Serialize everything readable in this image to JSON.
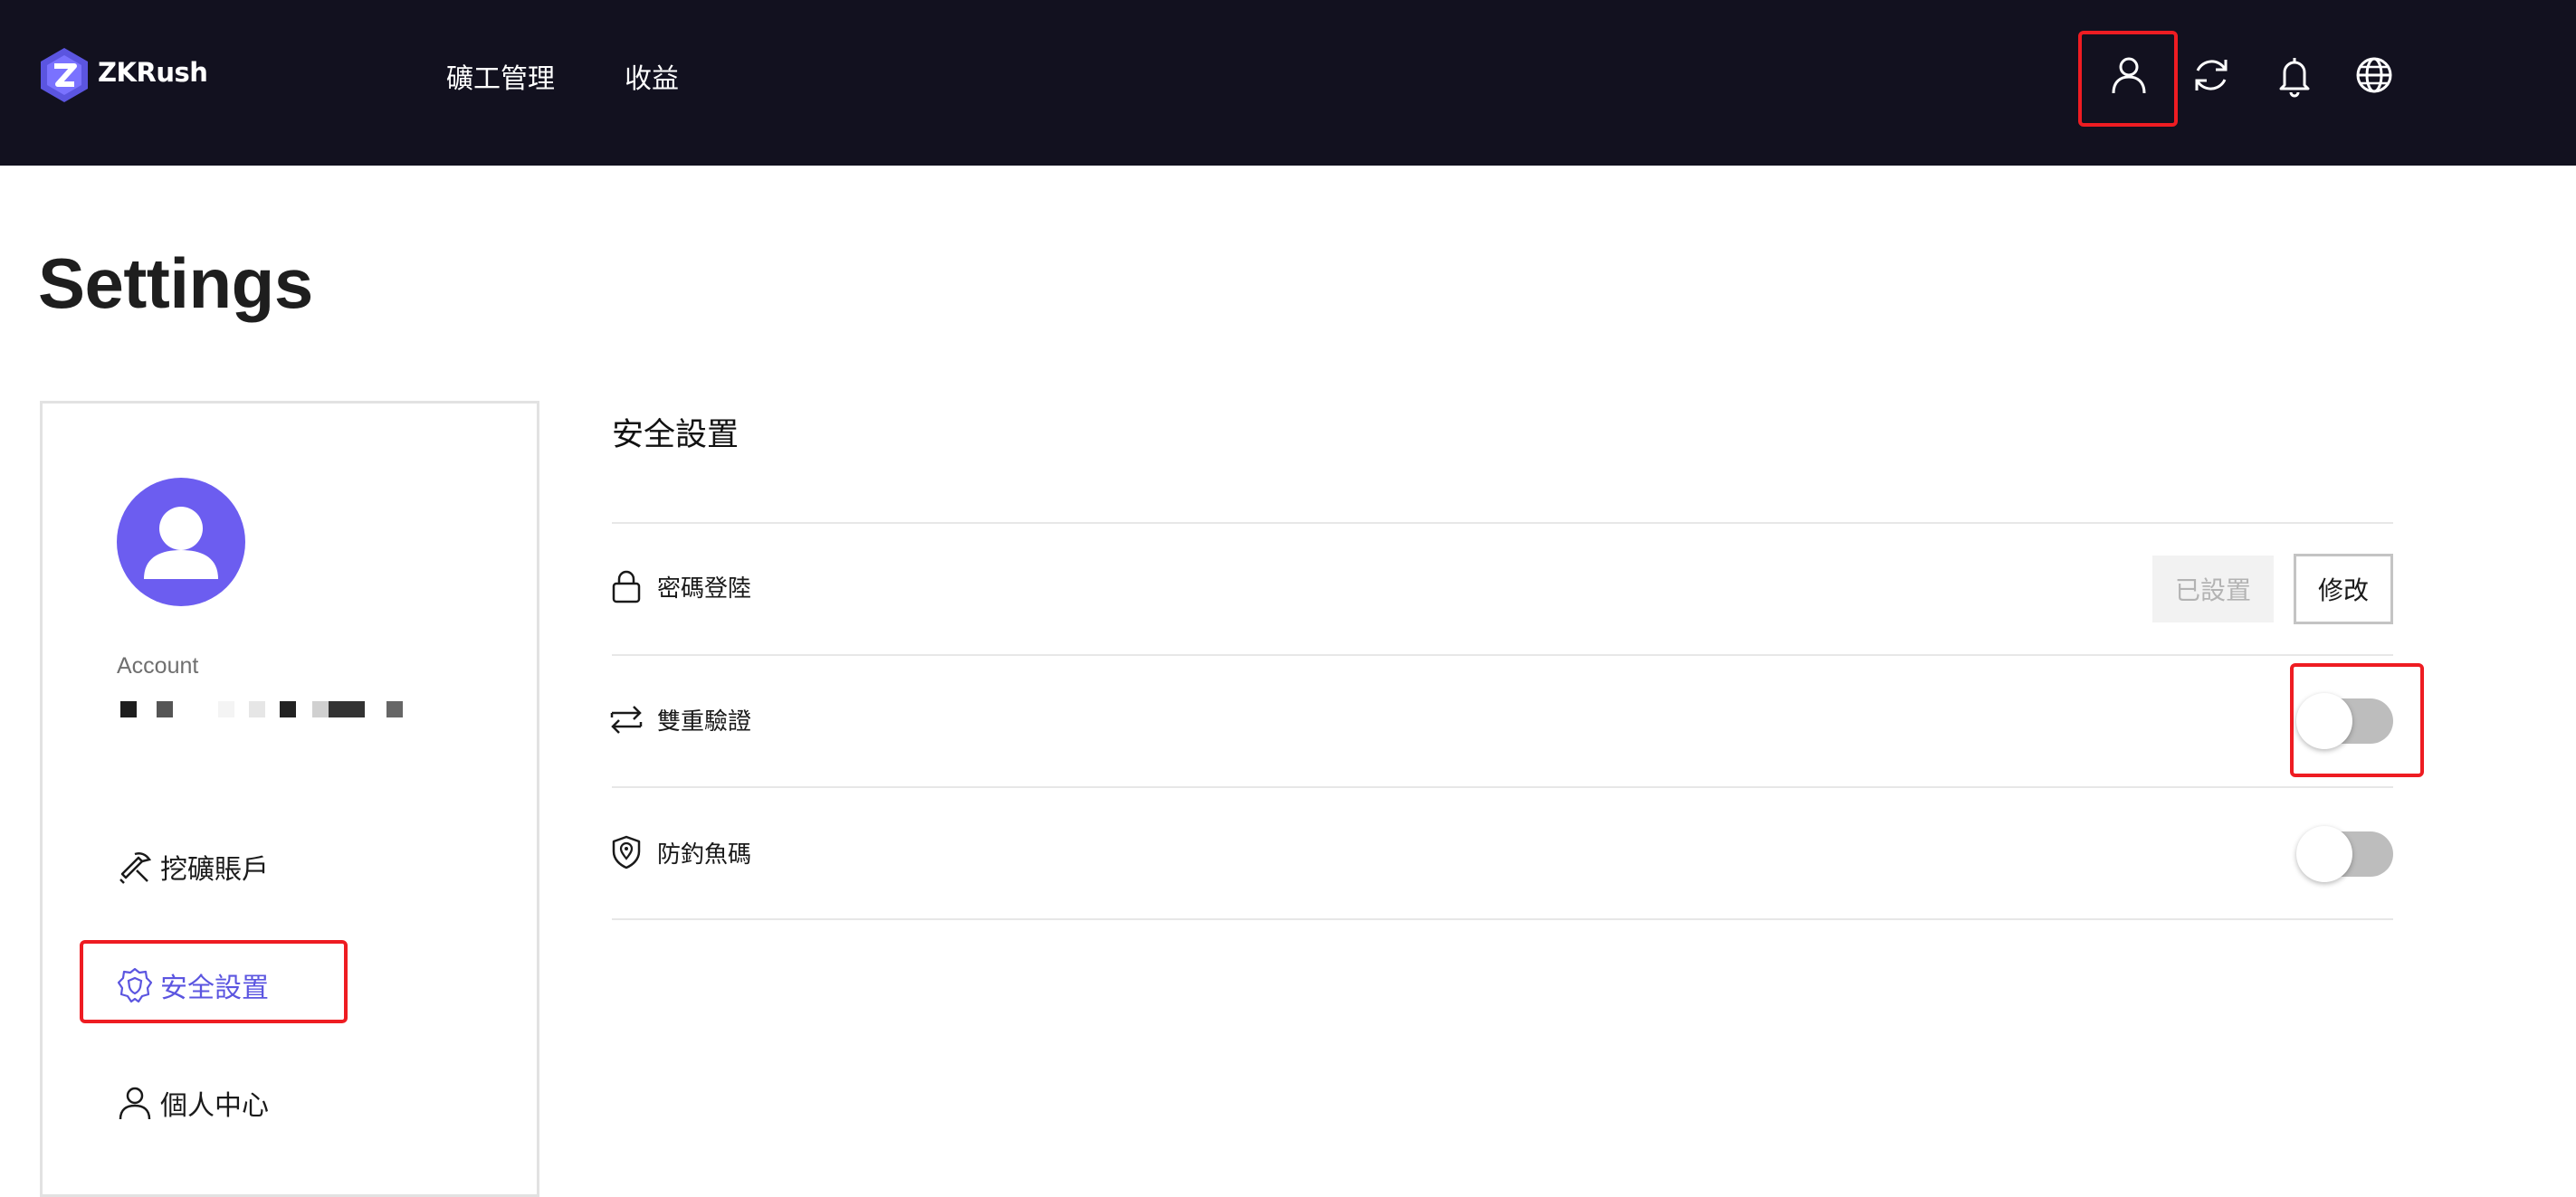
{
  "header": {
    "brand": "ZKRush",
    "nav": [
      {
        "label": "礦工管理"
      },
      {
        "label": "收益"
      }
    ],
    "icons": [
      "user-icon",
      "refresh-icon",
      "bell-icon",
      "globe-icon"
    ]
  },
  "page": {
    "title": "Settings"
  },
  "sidebar": {
    "account_label": "Account",
    "items": [
      {
        "label": "挖礦賬戶",
        "icon": "mining-tools-icon"
      },
      {
        "label": "安全設置",
        "icon": "shield-gear-icon",
        "active": true
      },
      {
        "label": "個人中心",
        "icon": "user-icon"
      }
    ]
  },
  "security": {
    "title": "安全設置",
    "rows": [
      {
        "label": "密碼登陸",
        "icon": "lock-icon",
        "status": "已設置",
        "action": "修改"
      },
      {
        "label": "雙重驗證",
        "icon": "swap-arrows-icon",
        "enabled": false
      },
      {
        "label": "防釣魚碼",
        "icon": "shield-pin-icon",
        "enabled": false
      }
    ]
  },
  "colors": {
    "nav_bg": "#12111f",
    "accent": "#6c5df0",
    "active_text": "#5b55e0",
    "highlight": "#ee1c22",
    "toggle_off": "#bdbdbd"
  }
}
